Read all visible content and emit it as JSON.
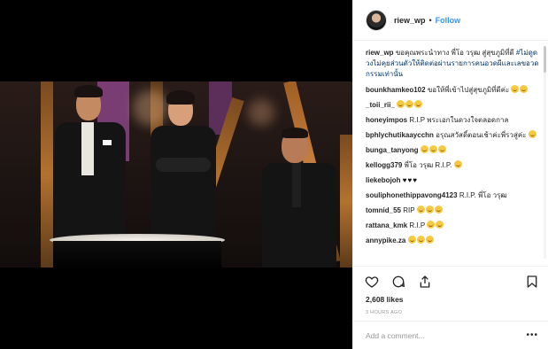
{
  "header": {
    "username": "riew_wp",
    "separator": "•",
    "follow_label": "Follow"
  },
  "caption": {
    "username": "riew_wp",
    "text": "ขอคุณพระนำทาง พี่โอ วรุฒ สู่สุขภูมิที่ดี",
    "hashtag": "#ไม่ดูดวงไม่คุยส่วนตัวให้ติดต่อผ่านรายการคนอวดผีและเลขอวดกรรมเท่านั้น"
  },
  "comments": [
    {
      "user": "bounkhamkeo102",
      "text": "ขอให้พี่เข้าไปสู่สุขภูมิที่ดีค่ะ",
      "emoji": 2,
      "hearts": ""
    },
    {
      "user": "_toii_rii_",
      "text": "",
      "emoji": 3,
      "hearts": ""
    },
    {
      "user": "honeyimpos",
      "text": "R.I.P พระเอกในดวงใจตลอดกาล",
      "emoji": 0,
      "hearts": ""
    },
    {
      "user": "bphlychutikaaycchn",
      "text": "อรุณสวัสดิ์ตอนเช้าค่ะพี่รวสู่ค่ะ",
      "emoji": 1,
      "hearts": ""
    },
    {
      "user": "bunga_tanyong",
      "text": "",
      "emoji": 3,
      "hearts": ""
    },
    {
      "user": "kellogg379",
      "text": "พี่โอ วรุฒ R.I.P.",
      "emoji": 1,
      "hearts": ""
    },
    {
      "user": "liekebojoh",
      "text": "",
      "emoji": 0,
      "hearts": "♥♥♥"
    },
    {
      "user": "souliphonethippavong4123",
      "text": "R.I.P. พี่โอ วรุฒ",
      "emoji": 0,
      "hearts": ""
    },
    {
      "user": "tomnid_55",
      "text": "RIP",
      "emoji": 3,
      "hearts": ""
    },
    {
      "user": "rattana_kmk",
      "text": "R.I.P",
      "emoji": 2,
      "hearts": ""
    },
    {
      "user": "annypike.za",
      "text": "",
      "emoji": 3,
      "hearts": ""
    }
  ],
  "icons": {
    "like": "heart-icon",
    "comment": "comment-icon",
    "share": "share-icon",
    "save": "bookmark-icon",
    "more": "more-options-icon"
  },
  "stats": {
    "likes": "2,608 likes",
    "time": "3 HOURS AGO"
  },
  "add_comment": {
    "placeholder": "Add a comment...",
    "more_label": "•••"
  }
}
